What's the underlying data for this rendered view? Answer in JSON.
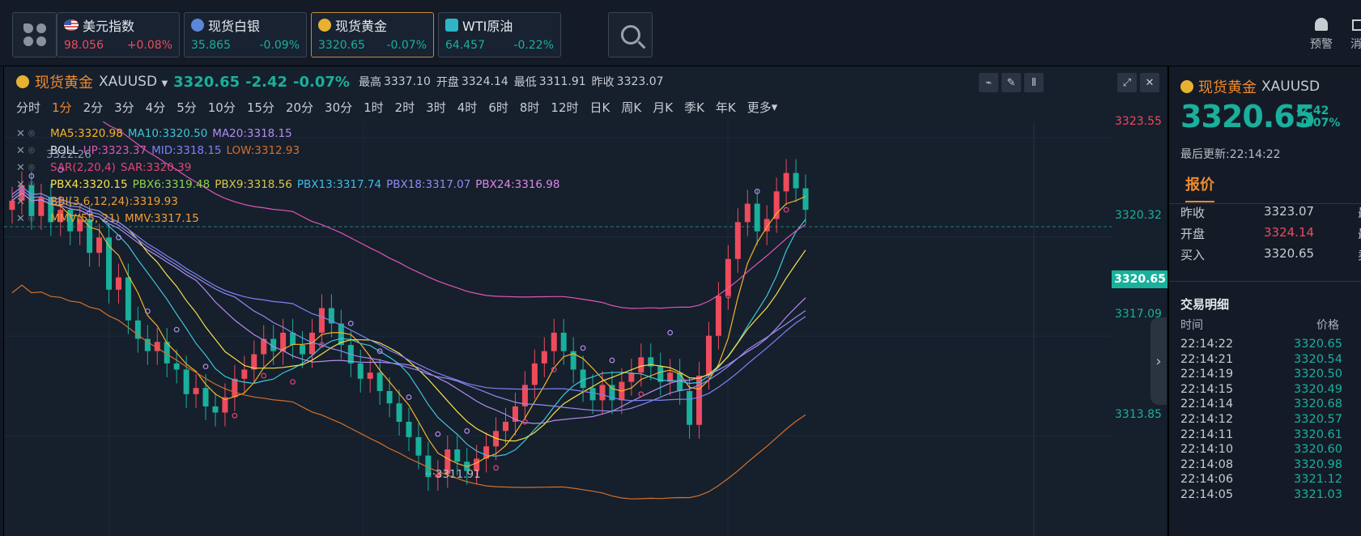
{
  "topbar": {
    "tickers": [
      {
        "name": "美元指数",
        "price": "98.056",
        "change": "+0.08%",
        "icon": "us-flag-icon",
        "dir": "up"
      },
      {
        "name": "现货白银",
        "price": "35.865",
        "change": "-0.09%",
        "icon": "silver-coin-icon",
        "dir": "down"
      },
      {
        "name": "现货黄金",
        "price": "3320.65",
        "change": "-0.07%",
        "icon": "gold-coin-icon",
        "dir": "down"
      },
      {
        "name": "WTI原油",
        "price": "64.457",
        "change": "-0.22%",
        "icon": "oil-icon",
        "dir": "down"
      }
    ],
    "alert_label": "预警",
    "message_label": "消"
  },
  "chart_header": {
    "name": "现货黄金",
    "code": "XAUUSD",
    "price": "3320.65",
    "change": "-2.42",
    "change_pct": "-0.07%",
    "high_label": "最高",
    "high": "3337.10",
    "open_label": "开盘",
    "open": "3324.14",
    "low_label": "最低",
    "low": "3311.91",
    "prev_close_label": "昨收",
    "prev_close": "3323.07",
    "periods": [
      "分时",
      "1分",
      "2分",
      "3分",
      "4分",
      "5分",
      "10分",
      "15分",
      "20分",
      "30分",
      "1时",
      "2时",
      "3时",
      "4时",
      "6时",
      "8时",
      "12时",
      "日K",
      "周K",
      "月K",
      "季K",
      "年K",
      "更多"
    ],
    "active_period": "1分"
  },
  "legend": {
    "ma": [
      "MA5:3320.98",
      "MA10:3320.50",
      "MA20:3318.15"
    ],
    "boll": [
      "BOLL",
      "UP:3323.37",
      "MID:3318.15",
      "LOW:3312.93"
    ],
    "sar": [
      "SAR(2,20,4)",
      "SAR:3320.39"
    ],
    "pbx": [
      "PBX4:3320.15",
      "PBX6:3319.48",
      "PBX9:3318.56",
      "PBX13:3317.74",
      "PBX18:3317.07",
      "PBX24:3316.98"
    ],
    "bbi": [
      "BBI(3,6,12,24):3319.93"
    ],
    "mmv": [
      "MMV(55, 21)",
      "MMV:3317.15"
    ],
    "overlay_value": "3322.26"
  },
  "axis": {
    "ticks": [
      "3323.55",
      "3320.32",
      "3317.09",
      "3313.85"
    ],
    "current_price": "3320.65",
    "min_label": "3311.91"
  },
  "colors": {
    "up": "#ee4b5c",
    "down": "#19b09c",
    "accent": "#f08a2c",
    "ma5": "#f7b32b",
    "ma10": "#3dc5d8",
    "ma20": "#b48cf0",
    "boll_up": "#e056b8",
    "boll_mid": "#7b84f5",
    "boll_low": "#d1702c"
  },
  "side_panel": {
    "name": "现货黄金",
    "code": "XAUUSD",
    "price": "3320.65",
    "change": "-2.42",
    "change_pct": "-0.07%",
    "updated": "最后更新:22:14:22",
    "tab": "报价",
    "quotes": [
      {
        "label": "昨收",
        "value": "3323.07",
        "label2": "最"
      },
      {
        "label": "开盘",
        "value": "3324.14",
        "label2": "最"
      },
      {
        "label": "买入",
        "value": "3320.65",
        "label2": "卖"
      }
    ],
    "trades_title": "交易明细",
    "trades_time_label": "时间",
    "trades_price_label": "价格",
    "trades": [
      {
        "time": "22:14:22",
        "price": "3320.65"
      },
      {
        "time": "22:14:21",
        "price": "3320.54"
      },
      {
        "time": "22:14:19",
        "price": "3320.50"
      },
      {
        "time": "22:14:15",
        "price": "3320.49"
      },
      {
        "time": "22:14:14",
        "price": "3320.68"
      },
      {
        "time": "22:14:12",
        "price": "3320.57"
      },
      {
        "time": "22:14:11",
        "price": "3320.61"
      },
      {
        "time": "22:14:10",
        "price": "3320.60"
      },
      {
        "time": "22:14:08",
        "price": "3320.98"
      },
      {
        "time": "22:14:06",
        "price": "3321.12"
      },
      {
        "time": "22:14:05",
        "price": "3321.03"
      }
    ]
  }
}
